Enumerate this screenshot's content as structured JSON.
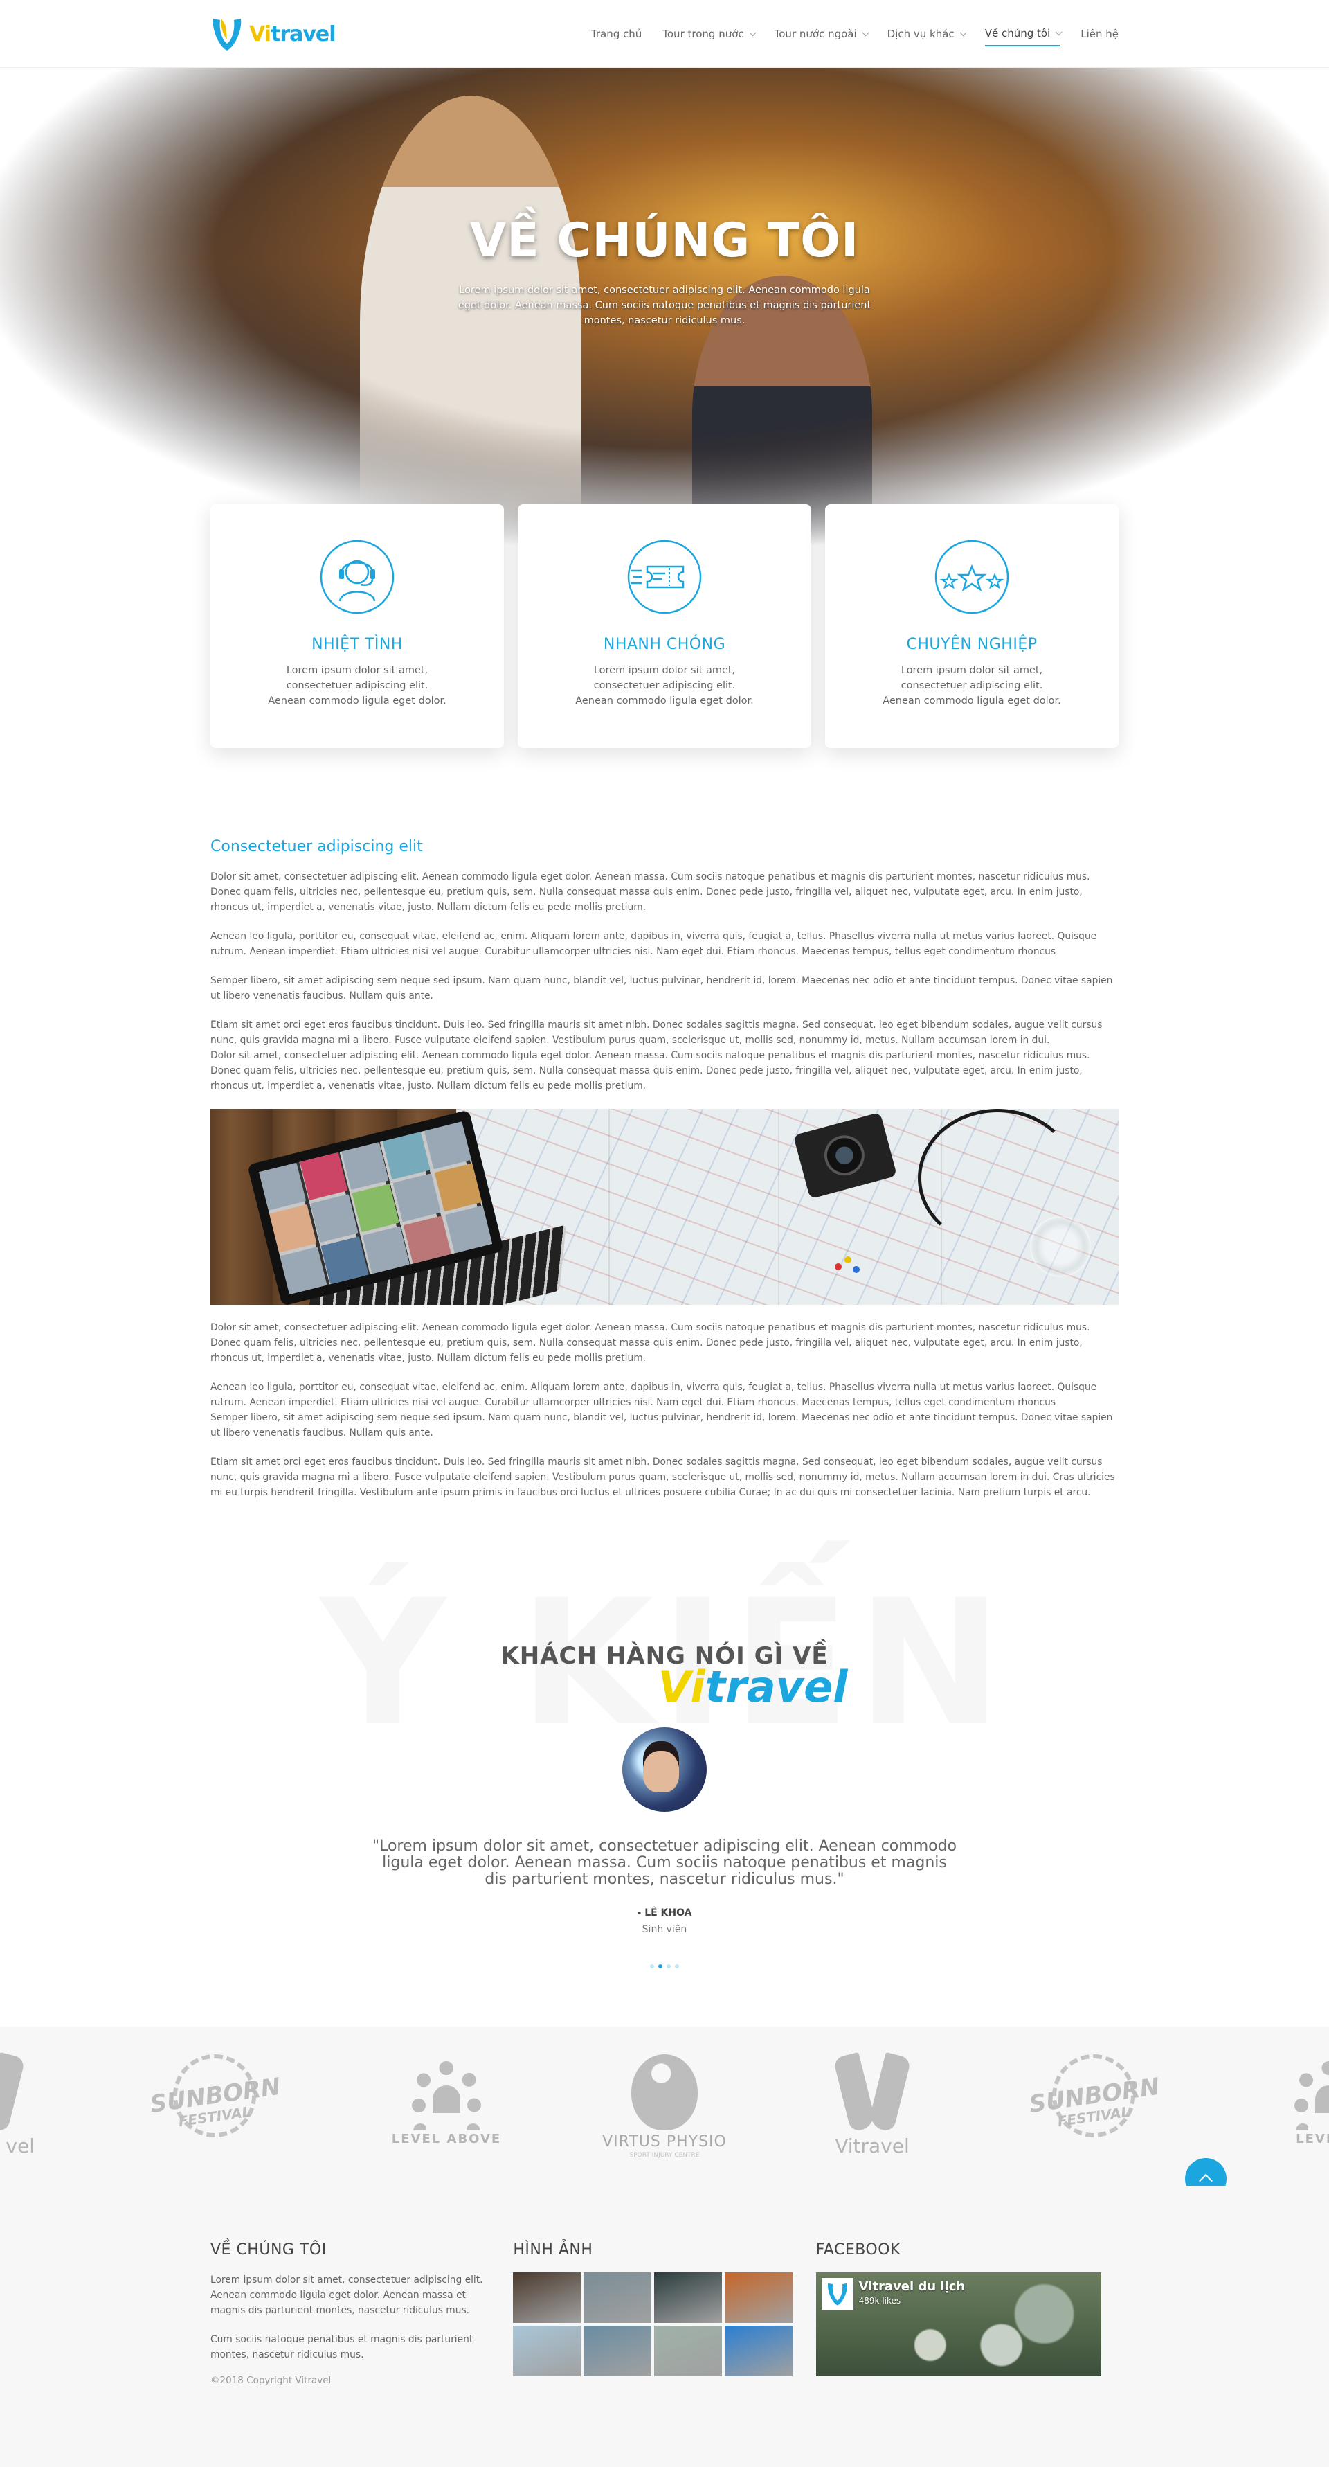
{
  "brand": {
    "logo_prefix": "Vi",
    "logo_suffix": "travel"
  },
  "nav": {
    "items": [
      {
        "label": "Trang chủ",
        "has_caret": false,
        "active": false
      },
      {
        "label": "Tour trong nước",
        "has_caret": true,
        "active": false
      },
      {
        "label": "Tour nước ngoài",
        "has_caret": true,
        "active": false
      },
      {
        "label": "Dịch vụ khác",
        "has_caret": true,
        "active": false
      },
      {
        "label": "Về chúng tôi",
        "has_caret": true,
        "active": true
      },
      {
        "label": "Liên hệ",
        "has_caret": false,
        "active": false
      }
    ]
  },
  "hero": {
    "title": "VỀ CHÚNG TÔI",
    "subtitle": "Lorem ipsum dolor sit amet, consectetuer adipiscing elit. Aenean commodo ligula eget dolor. Aenean massa. Cum sociis natoque penatibus et magnis dis parturient montes, nascetur ridiculus mus."
  },
  "features": [
    {
      "icon": "support-agent-icon",
      "title": "NHIỆT TÌNH",
      "text": "Lorem ipsum dolor sit amet, consectetuer adipiscing elit. Aenean commodo ligula eget dolor."
    },
    {
      "icon": "ticket-icon",
      "title": "NHANH CHÓNG",
      "text": "Lorem ipsum dolor sit amet, consectetuer adipiscing elit. Aenean commodo ligula eget dolor."
    },
    {
      "icon": "stars-icon",
      "title": "CHUYÊN NGHIỆP",
      "text": "Lorem ipsum dolor sit amet, consectetuer adipiscing elit. Aenean commodo ligula eget dolor."
    }
  ],
  "article": {
    "heading": "Consectetuer adipiscing elit",
    "p1": "Dolor sit amet, consectetuer adipiscing elit. Aenean commodo ligula eget dolor. Aenean massa. Cum sociis natoque penatibus et magnis dis parturient montes, nascetur ridiculus mus. Donec quam felis, ultricies nec, pellentesque eu, pretium quis, sem. Nulla consequat massa quis enim. Donec pede justo, fringilla vel, aliquet nec, vulputate eget, arcu. In enim justo, rhoncus ut, imperdiet a, venenatis vitae, justo. Nullam dictum felis eu pede mollis pretium.",
    "p2": "Aenean leo ligula, porttitor eu, consequat vitae, eleifend ac, enim. Aliquam lorem ante, dapibus in, viverra quis, feugiat a, tellus. Phasellus viverra nulla ut metus varius laoreet. Quisque rutrum. Aenean imperdiet. Etiam ultricies nisi vel augue. Curabitur ullamcorper ultricies nisi. Nam eget dui. Etiam rhoncus. Maecenas tempus, tellus eget condimentum rhoncus",
    "p3": "Semper libero, sit amet adipiscing sem neque sed ipsum. Nam quam nunc, blandit vel, luctus pulvinar, hendrerit id, lorem. Maecenas nec odio et ante tincidunt tempus. Donec vitae sapien ut libero venenatis faucibus. Nullam quis ante.",
    "p4a": "Etiam sit amet orci eget eros faucibus tincidunt. Duis leo. Sed fringilla mauris sit amet nibh. Donec sodales sagittis magna. Sed consequat, leo eget bibendum sodales, augue velit cursus nunc, quis gravida magna mi a libero. Fusce vulputate eleifend sapien. Vestibulum purus quam, scelerisque ut, mollis sed, nonummy id, metus. Nullam accumsan lorem in dui.",
    "p4b": "Dolor sit amet, consectetuer adipiscing elit. Aenean commodo ligula eget dolor. Aenean massa. Cum sociis natoque penatibus et magnis dis parturient montes, nascetur ridiculus mus. Donec quam felis, ultricies nec, pellentesque eu, pretium quis, sem. Nulla consequat massa quis enim. Donec pede justo, fringilla vel, aliquet nec, vulputate eget, arcu. In enim justo, rhoncus ut, imperdiet a, venenatis vitae, justo. Nullam dictum felis eu pede mollis pretium.",
    "p5": "Dolor sit amet, consectetuer adipiscing elit. Aenean commodo ligula eget dolor. Aenean massa. Cum sociis natoque penatibus et magnis dis parturient montes, nascetur ridiculus mus. Donec quam felis, ultricies nec, pellentesque eu, pretium quis, sem. Nulla consequat massa quis enim. Donec pede justo, fringilla vel, aliquet nec, vulputate eget, arcu. In enim justo, rhoncus ut, imperdiet a, venenatis vitae, justo. Nullam dictum felis eu pede mollis pretium.",
    "p6a": "Aenean leo ligula, porttitor eu, consequat vitae, eleifend ac, enim. Aliquam lorem ante, dapibus in, viverra quis, feugiat a, tellus. Phasellus viverra nulla ut metus varius laoreet. Quisque rutrum. Aenean imperdiet. Etiam ultricies nisi vel augue. Curabitur ullamcorper ultricies nisi. Nam eget dui. Etiam rhoncus. Maecenas tempus, tellus eget condimentum rhoncus",
    "p6b": "Semper libero, sit amet adipiscing sem neque sed ipsum. Nam quam nunc, blandit vel, luctus pulvinar, hendrerit id, lorem. Maecenas nec odio et ante tincidunt tempus. Donec vitae sapien ut libero venenatis faucibus. Nullam quis ante.",
    "p7": "Etiam sit amet orci eget eros faucibus tincidunt. Duis leo. Sed fringilla mauris sit amet nibh. Donec sodales sagittis magna. Sed consequat, leo eget bibendum sodales, augue velit cursus nunc, quis gravida magna mi a libero. Fusce vulputate eleifend sapien. Vestibulum purus quam, scelerisque ut, mollis sed, nonummy id, metus. Nullam accumsan lorem in dui. Cras ultricies mi eu turpis hendrerit fringilla. Vestibulum ante ipsum primis in faucibus orci luctus et ultrices posuere cubilia Curae; In ac dui quis mi consectetuer lacinia. Nam pretium turpis et arcu."
  },
  "testimonials": {
    "bg_text": "Ý KIẾN",
    "heading": "KHÁCH HÀNG NÓI GÌ VỀ",
    "brand_prefix": "Vi",
    "brand_suffix": "travel",
    "quote": "\"Lorem ipsum dolor sit amet, consectetuer adipiscing elit. Aenean commodo ligula eget dolor. Aenean massa. Cum sociis natoque penatibus et magnis dis parturient montes, nascetur ridiculus mus.\"",
    "author": "- LÊ KHOA",
    "role": "Sinh viên",
    "dots_total": 4,
    "dots_active_index": 1
  },
  "partners": {
    "sunborn_top": "SUNBORN",
    "sunborn_bottom": "FESTIVAL",
    "level_above": "LEVEL ABOVE",
    "virtus": "VIRTUS PHYSIO",
    "virtus_sub": "SPORT INJURY CENTRE",
    "vitravel": "Vitravel",
    "vel_partial": "vel",
    "level_partial": "LEVEL A"
  },
  "footer": {
    "about": {
      "title": "VỀ CHÚNG TÔI",
      "p1": "Lorem ipsum dolor sit amet, consectetuer adipiscing elit. Aenean commodo ligula eget dolor. Aenean massa et magnis dis parturient montes, nascetur ridiculus mus.",
      "p2": "Cum sociis natoque penatibus et magnis dis parturient montes, nascetur ridiculus mus.",
      "copyright": "©2018 Copyright Vitravel"
    },
    "gallery": {
      "title": "HÌNH ẢNH",
      "colors": [
        "#4b3a2e",
        "#7a8d96",
        "#2c3d3f",
        "#c5662a",
        "#a9c6d8",
        "#6a8da3",
        "#9fb2a8",
        "#2c7fd1"
      ]
    },
    "facebook": {
      "title": "FACEBOOK",
      "page_name": "Vitravel du lịch",
      "likes": "489k likes"
    }
  },
  "colors": {
    "accent": "#1ba6df",
    "yellow": "#f2c200",
    "text": "#666666"
  }
}
